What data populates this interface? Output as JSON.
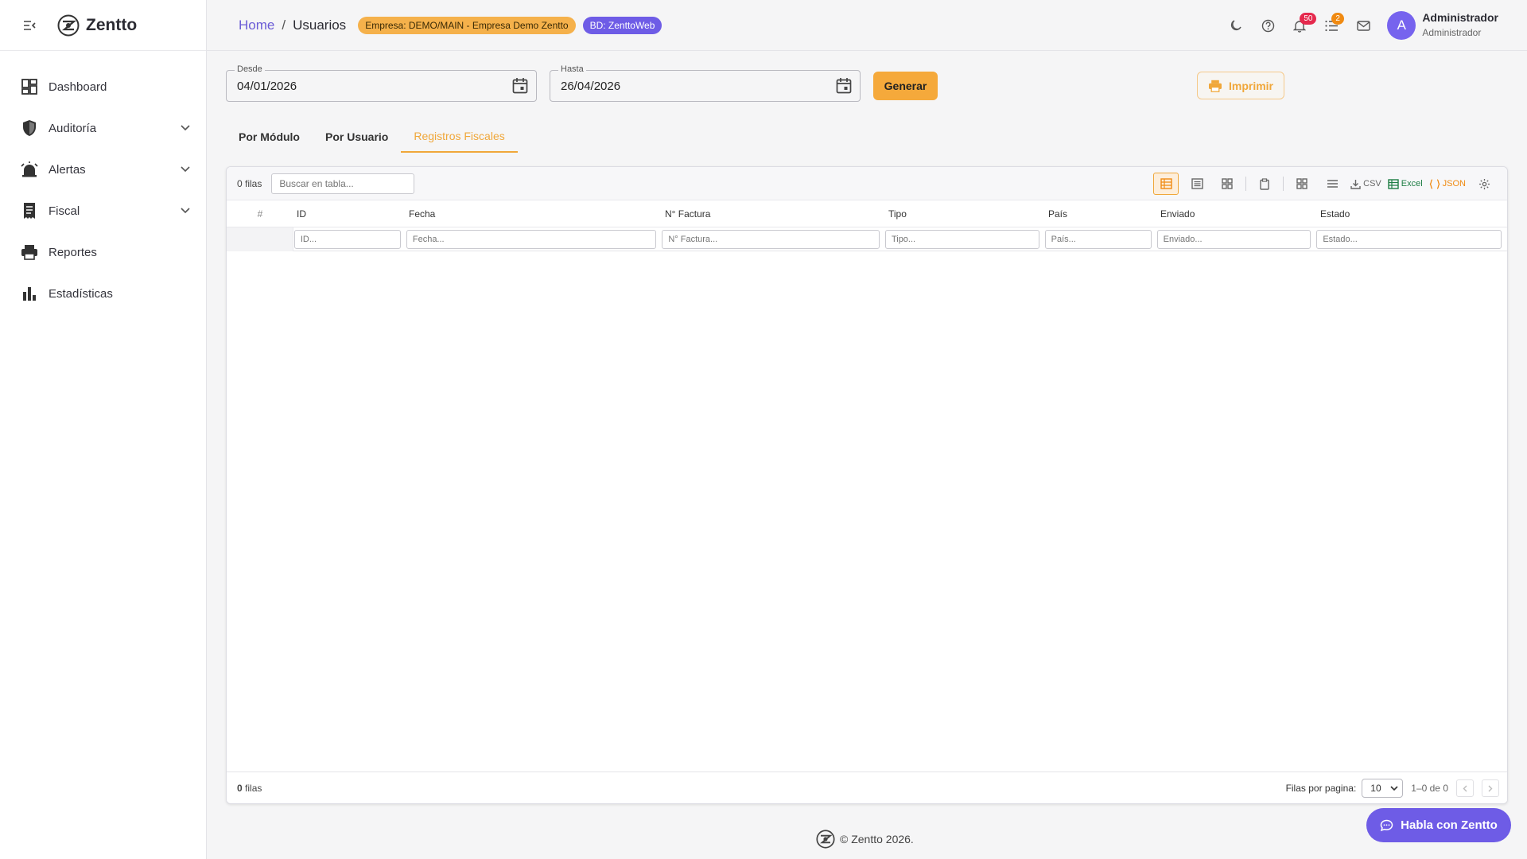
{
  "app": {
    "name": "Zentto"
  },
  "sidebar": {
    "items": [
      {
        "label": "Dashboard",
        "icon": "dashboard-icon",
        "expandable": false
      },
      {
        "label": "Auditoría",
        "icon": "shield-icon",
        "expandable": true
      },
      {
        "label": "Alertas",
        "icon": "alarm-icon",
        "expandable": true
      },
      {
        "label": "Fiscal",
        "icon": "receipt-icon",
        "expandable": true
      },
      {
        "label": "Reportes",
        "icon": "printer-icon",
        "expandable": false
      },
      {
        "label": "Estadísticas",
        "icon": "bar-chart-icon",
        "expandable": false
      }
    ]
  },
  "header": {
    "breadcrumb": {
      "home": "Home",
      "separator": "/",
      "current": "Usuarios"
    },
    "empresa_badge": "Empresa: DEMO/MAIN - Empresa Demo Zentto",
    "db_badge": "BD: ZenttoWeb",
    "notifications_count": "50",
    "tasks_count": "2",
    "user": {
      "initial": "A",
      "name": "Administrador",
      "role": "Administrador"
    }
  },
  "filters": {
    "desde": {
      "label": "Desde",
      "value": "04/01/2026"
    },
    "hasta": {
      "label": "Hasta",
      "value": "26/04/2026"
    },
    "generate_label": "Generar",
    "print_label": "Imprimir"
  },
  "tabs": [
    {
      "label": "Por Módulo",
      "active": false
    },
    {
      "label": "Por Usuario",
      "active": false
    },
    {
      "label": "Registros Fiscales",
      "active": true
    }
  ],
  "grid": {
    "row_count_label": "0 filas",
    "search_placeholder": "Buscar en tabla...",
    "toolbar": {
      "csv": "CSV",
      "excel": "Excel",
      "json": "JSON"
    },
    "index_header": "#",
    "columns": [
      {
        "header": "ID",
        "filter_placeholder": "ID..."
      },
      {
        "header": "Fecha",
        "filter_placeholder": "Fecha..."
      },
      {
        "header": "N° Factura",
        "filter_placeholder": "N° Factura..."
      },
      {
        "header": "Tipo",
        "filter_placeholder": "Tipo..."
      },
      {
        "header": "País",
        "filter_placeholder": "País..."
      },
      {
        "header": "Enviado",
        "filter_placeholder": "Enviado..."
      },
      {
        "header": "Estado",
        "filter_placeholder": "Estado..."
      }
    ],
    "rows": [],
    "footer": {
      "count_number": "0",
      "count_suffix": "filas",
      "rows_per_page_label": "Filas por pagina:",
      "rows_per_page_value": "10",
      "range_label": "1–0 de 0"
    }
  },
  "footer": {
    "copyright": "© Zentto 2026."
  },
  "chat": {
    "label": "Habla con Zentto"
  },
  "colors": {
    "accent": "#f0a73a",
    "brand": "#6e5ce6",
    "badge_empresa": "#f5b14b",
    "notif_red": "#e5294d",
    "notif_orange": "#f08a12"
  }
}
